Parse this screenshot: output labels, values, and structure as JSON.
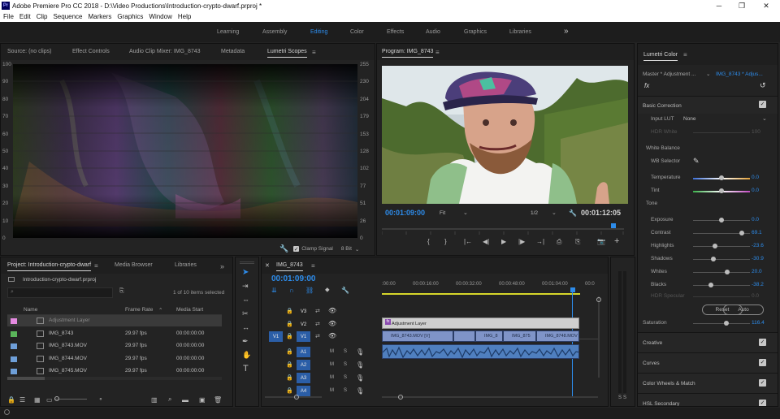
{
  "app": {
    "title": "Adobe Premiere Pro CC 2018 - D:\\Video Productions\\Introduction-crypto-dwarf.prproj *",
    "logo_text": "Pr",
    "window_controls": [
      "─",
      "❐",
      "✕"
    ]
  },
  "menu": [
    "File",
    "Edit",
    "Clip",
    "Sequence",
    "Markers",
    "Graphics",
    "Window",
    "Help"
  ],
  "workspaces": {
    "items": [
      "Learning",
      "Assembly",
      "Editing",
      "Color",
      "Effects",
      "Audio",
      "Graphics",
      "Libraries"
    ],
    "active": "Editing",
    "overflow": "»"
  },
  "source_panel": {
    "tabs": [
      "Source: (no clips)",
      "Effect Controls",
      "Audio Clip Mixer: IMG_8743",
      "Metadata",
      "Lumetri Scopes"
    ],
    "active_tab": "Lumetri Scopes",
    "scale_left": [
      "100",
      "90",
      "80",
      "70",
      "60",
      "50",
      "40",
      "30",
      "20",
      "10",
      "0"
    ],
    "scale_right": [
      "255",
      "230",
      "204",
      "179",
      "153",
      "128",
      "102",
      "77",
      "51",
      "26",
      "0"
    ],
    "clamp_signal_label": "Clamp Signal",
    "bit_depth": "8 Bit"
  },
  "program_monitor": {
    "title": "Program: IMG_8743",
    "current_tc": "00:01:09:00",
    "fit": "Fit",
    "resolution": "1/2",
    "duration_tc": "00:01:12:05",
    "controls": [
      "{",
      "}",
      "|←",
      "◀|",
      "▶",
      "|▶",
      "→|",
      "⎙",
      "⎘",
      "📷",
      "+"
    ]
  },
  "lumetri": {
    "title": "Lumetri Color",
    "master": "Master * Adjustment ...",
    "clip": "IMG_8743 * Adjus...",
    "fx": "fx",
    "basic_correction": "Basic Correction",
    "input_lut_label": "Input LUT",
    "input_lut_value": "None",
    "hdr_white_label": "HDR White",
    "hdr_white_value": "100",
    "white_balance": "White Balance",
    "wb_selector": "WB Selector",
    "tone": "Tone",
    "sliders": [
      {
        "label": "Temperature",
        "value": "0.0",
        "pos": 0.5
      },
      {
        "label": "Tint",
        "value": "0.0",
        "pos": 0.5
      },
      {
        "label": "Exposure",
        "value": "0.0",
        "pos": 0.5
      },
      {
        "label": "Contrast",
        "value": "69.1",
        "pos": 0.85
      },
      {
        "label": "Highlights",
        "value": "-23.6",
        "pos": 0.38
      },
      {
        "label": "Shadows",
        "value": "-30.9",
        "pos": 0.35
      },
      {
        "label": "Whites",
        "value": "20.0",
        "pos": 0.6
      },
      {
        "label": "Blacks",
        "value": "-38.2",
        "pos": 0.31
      }
    ],
    "hdr_specular_label": "HDR Specular",
    "hdr_specular_value": "0.0",
    "reset": "Reset",
    "auto": "Auto",
    "saturation_label": "Saturation",
    "saturation_value": "116.4",
    "sections": [
      "Creative",
      "Curves",
      "Color Wheels & Match",
      "HSL Secondary"
    ]
  },
  "project": {
    "tabs": [
      "Project: Introduction-crypto-dwarf",
      "Media Browser",
      "Libraries"
    ],
    "active_tab": "Project: Introduction-crypto-dwarf",
    "file": "Introduction-crypto-dwarf.prproj",
    "selection": "1 of 10 items selected",
    "columns": [
      "Name",
      "Frame Rate",
      "Media Start"
    ],
    "rows": [
      {
        "name": "Adjustment Layer",
        "rate": "",
        "start": "",
        "color": "#e58ae0"
      },
      {
        "name": "IMG_8743",
        "rate": "29.97 fps",
        "start": "00:00:00:00",
        "color": "#5ab55a"
      },
      {
        "name": "IMG_8743.MOV",
        "rate": "29.97 fps",
        "start": "00:00:00:00",
        "color": "#6e9fd8"
      },
      {
        "name": "IMG_8744.MOV",
        "rate": "29.97 fps",
        "start": "00:00:00:00",
        "color": "#6e9fd8"
      },
      {
        "name": "IMG_8745.MOV",
        "rate": "29.97 fps",
        "start": "00:00:00:00",
        "color": "#6e9fd8"
      }
    ]
  },
  "timeline": {
    "sequence": "IMG_8743",
    "current_tc": "00:01:09:00",
    "ruler": [
      ":00:00",
      "00:00:16:00",
      "00:00:32:00",
      "00:00:48:00",
      "00:01:04:00",
      "00:0"
    ],
    "tracks": [
      "V3",
      "V2",
      "V1",
      "A1",
      "A2",
      "A3",
      "A4"
    ],
    "source_patch": "V1",
    "adjustment_clip": "Adjustment Layer",
    "video_clips": [
      "IMG_8743.MOV [V]",
      "IMG_8",
      "IMG_875",
      "IMG_8748.MOV [V]"
    ],
    "audio_meter": [
      "S",
      "S"
    ]
  }
}
